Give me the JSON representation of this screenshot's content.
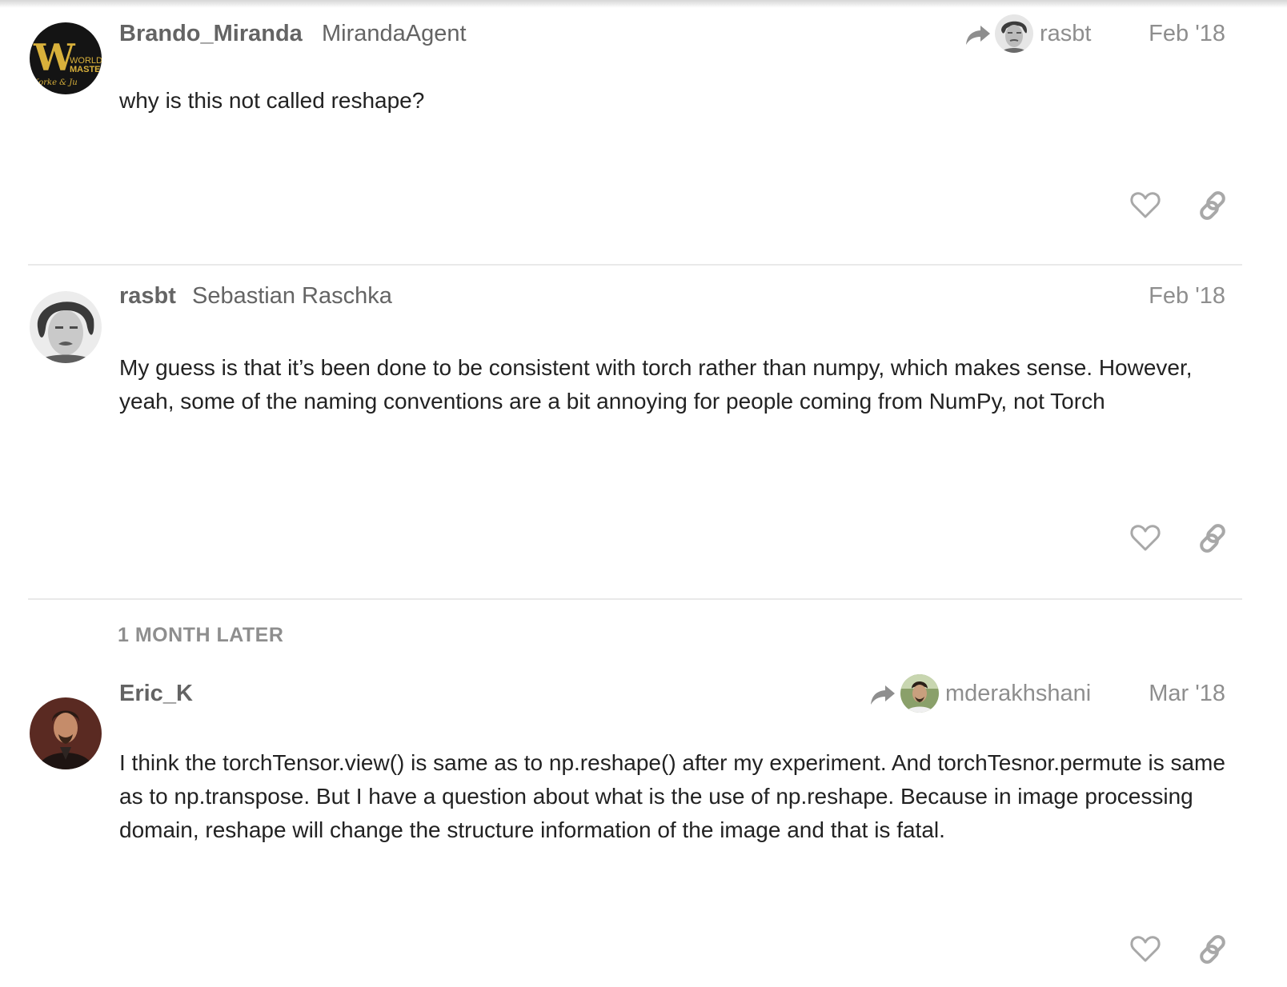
{
  "posts": [
    {
      "username": "Brando_Miranda",
      "full_name": "MirandaAgent",
      "avatar_icon": "world-masters-logo-avatar",
      "avatar_text": {
        "line1": "WORLD",
        "line2": "MASTE",
        "line3": "Korke & Ju",
        "letter": "W"
      },
      "reply_to": "rasbt",
      "date": "Feb '18",
      "body": "why is this not called reshape?"
    },
    {
      "username": "rasbt",
      "full_name": "Sebastian Raschka",
      "avatar_icon": "bw-portrait-avatar",
      "date": "Feb '18",
      "body": "My guess is that it’s been done to be consistent with torch rather than numpy, which makes sense. However, yeah, some of the naming conventions are a bit annoying for people coming from NumPy, not Torch"
    },
    {
      "username": "Eric_K",
      "avatar_icon": "portrait-avatar",
      "reply_to": "mderakhshani",
      "date": "Mar '18",
      "body": "I think the torchTensor.view() is same as to np.reshape() after my experiment. And torchTesnor.permute is same as to np.transpose. But I have a question about what is the use of np.reshape. Because in image processing domain, reshape will change the structure information of the image and that is fatal."
    }
  ],
  "time_gap": "1 MONTH LATER",
  "icons": {
    "like": "heart-icon",
    "link": "link-icon",
    "reply": "reply-arrow-icon"
  },
  "colors": {
    "username": "#646464",
    "meta": "#8e8e8e",
    "body": "#222222",
    "icon": "#a8a8a8",
    "divider": "#e9e9e9",
    "logo_gold": "#d9b13b"
  }
}
